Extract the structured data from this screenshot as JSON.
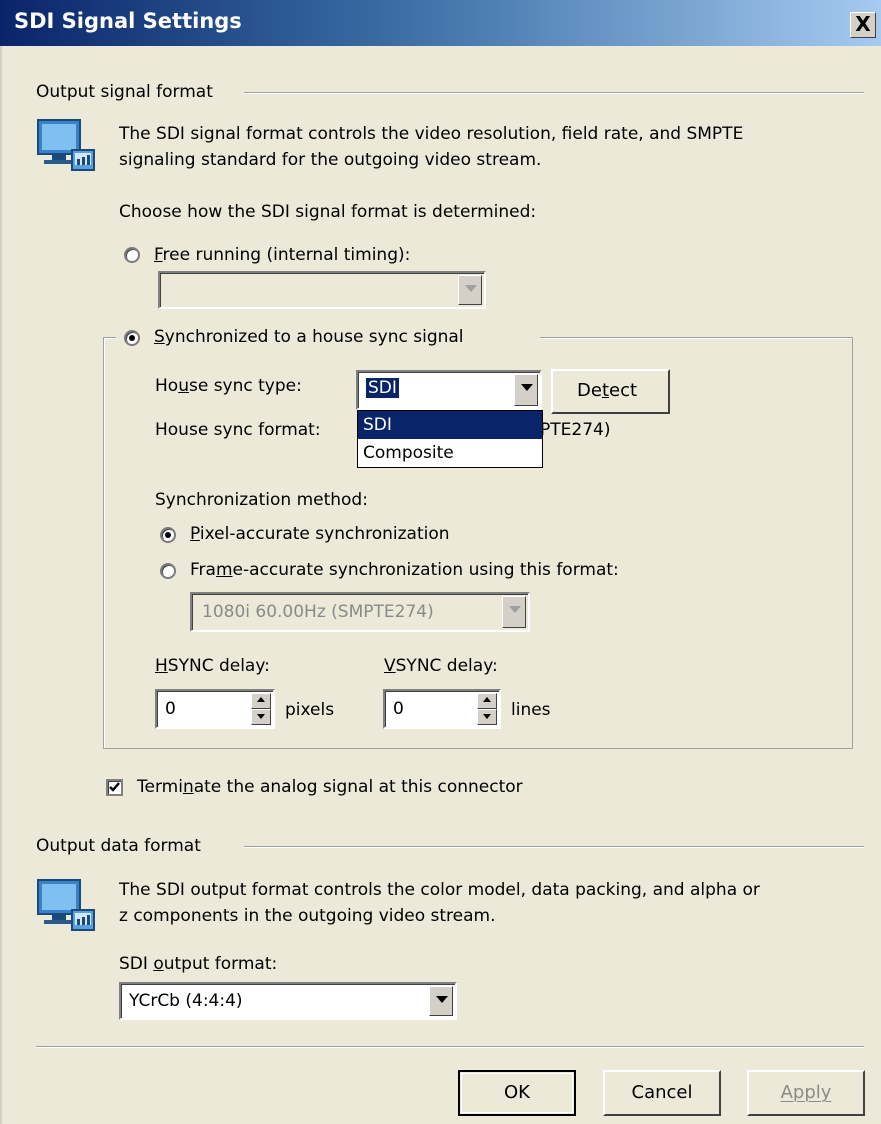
{
  "window": {
    "title": "SDI Signal Settings",
    "close_label": "X"
  },
  "output_signal": {
    "section_label": "Output signal format",
    "description_line1": "The SDI signal format controls the video resolution, field rate, and SMPTE",
    "description_line2": "signaling standard for the outgoing video stream.",
    "choose_label": "Choose how the SDI signal format is determined:",
    "free_running": {
      "prefix": "",
      "accel": "F",
      "rest": "ree running (internal timing):",
      "selected": false
    },
    "free_running_combo_value": "",
    "synchronized": {
      "accel": "S",
      "rest": "ynchronized to a house sync signal",
      "selected": true
    },
    "house_sync_type": {
      "label_pre": "Ho",
      "label_accel": "u",
      "label_post": "se sync type:",
      "value": "SDI"
    },
    "detect_button": {
      "pre": "De",
      "accel": "t",
      "post": "ect"
    },
    "house_sync_format": {
      "label": "House sync format:",
      "value_tail": "PTE274)"
    },
    "dropdown_options": [
      "SDI",
      "Composite"
    ],
    "sync_method_label": "Synchronization method:",
    "pixel_accurate": {
      "accel": "P",
      "rest": "ixel-accurate synchronization",
      "selected": true
    },
    "frame_accurate": {
      "pre": "Fra",
      "accel": "m",
      "rest": "e-accurate synchronization using this format:",
      "selected": false
    },
    "frame_format_value": "1080i 60.00Hz (SMPTE274)",
    "hsync": {
      "label_accel": "H",
      "label_rest": "SYNC delay:",
      "value": "0",
      "unit": "pixels"
    },
    "vsync": {
      "label_accel": "V",
      "label_rest": "SYNC delay:",
      "value": "0",
      "unit": "lines"
    }
  },
  "terminate": {
    "pre": "Termi",
    "accel": "n",
    "rest": "ate the analog signal at this connector",
    "checked": true
  },
  "output_data": {
    "section_label": "Output data format",
    "description_line1": "The SDI output format controls the color model, data packing, and alpha or",
    "description_line2": "z components in the outgoing video stream.",
    "format_label_pre": "SDI ",
    "format_label_accel": "o",
    "format_label_post": "utput format:",
    "format_value": "YCrCb (4:4:4)"
  },
  "buttons": {
    "ok": "OK",
    "cancel": "Cancel",
    "apply": "Apply"
  },
  "colors": {
    "title_dark": "#0a246a",
    "selection": "#0a246a",
    "face": "#ece9d8"
  },
  "icons": {
    "section_icon": "monitor-network-icon"
  }
}
